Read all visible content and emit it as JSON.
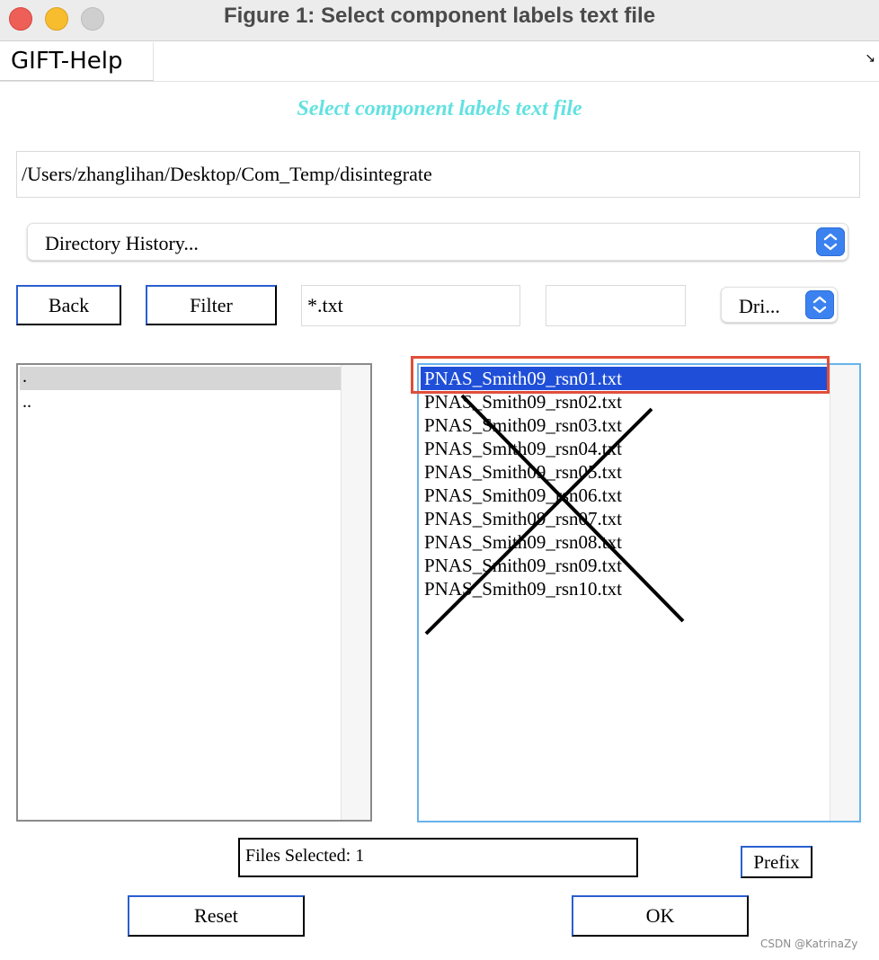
{
  "window": {
    "title": "Figure 1: Select component labels text file"
  },
  "menu": {
    "items": [
      "GIFT-Help"
    ],
    "dock_icon": "undock-arrow-icon"
  },
  "heading": "Select component labels text file",
  "path": "/Users/zhanglihan/Desktop/Com_Temp/disintegrate",
  "directory_history": {
    "label": "Directory History..."
  },
  "toolbar": {
    "back_label": "Back",
    "filter_label": "Filter",
    "filter_value": "*.txt",
    "extra_value": "",
    "drive_label": "Dri..."
  },
  "directories": [
    ".",
    ".."
  ],
  "files": [
    "PNAS_Smith09_rsn01.txt",
    "PNAS_Smith09_rsn02.txt",
    "PNAS_Smith09_rsn03.txt",
    "PNAS_Smith09_rsn04.txt",
    "PNAS_Smith09_rsn05.txt",
    "PNAS_Smith09_rsn06.txt",
    "PNAS_Smith09_rsn07.txt",
    "PNAS_Smith09_rsn08.txt",
    "PNAS_Smith09_rsn09.txt",
    "PNAS_Smith09_rsn10.txt"
  ],
  "selected_file_index": 0,
  "status": {
    "files_selected": "Files Selected: 1"
  },
  "buttons": {
    "prefix_label": "Prefix",
    "reset_label": "Reset",
    "ok_label": "OK"
  },
  "watermark": "CSDN @KatrinaZy",
  "colors": {
    "heading": "#63e1e1",
    "selection": "#1f4fd8",
    "annotation_box": "#e04e39",
    "stepper": "#3b82f0"
  }
}
